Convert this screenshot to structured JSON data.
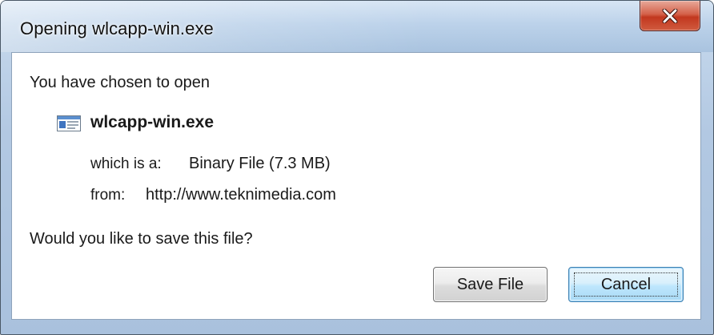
{
  "window": {
    "title": "Opening wlcapp-win.exe"
  },
  "dialog": {
    "intro": "You have chosen to open",
    "file": {
      "icon": "executable-file-icon",
      "name": "wlcapp-win.exe"
    },
    "type_label": "which is a:",
    "type_value": "Binary File (7.3 MB)",
    "from_label": "from:",
    "from_value": "http://www.teknimedia.com",
    "question": "Would you like to save this file?"
  },
  "buttons": {
    "save_label": "Save File",
    "cancel_label": "Cancel",
    "close_icon": "close-x-icon"
  },
  "colors": {
    "titlebar": "#bcd2ea",
    "close_button": "#c2381f",
    "default_button_border": "#3c7fb1"
  }
}
